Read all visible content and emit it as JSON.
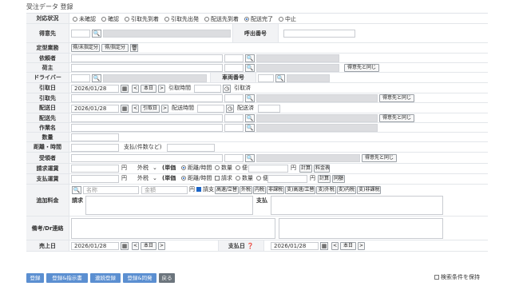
{
  "page_title": "受注データ 登録",
  "status": {
    "label": "対応状況",
    "options": [
      "未確認",
      "確認",
      "引取先到着",
      "引取先出発",
      "配送先到着",
      "配送完了",
      "中止"
    ],
    "selected": "配送完了"
  },
  "labels": {
    "customer": "得意先",
    "caller": "呼出番号",
    "fixed": "定型業務",
    "requester": "依頼者",
    "shipper": "荷主",
    "driver": "ドライバー",
    "vehicle": "車両番号",
    "pickup_date": "引取日",
    "pickup_place": "引取先",
    "delivery_date": "配送日",
    "delivery_place": "配送先",
    "work_name": "作業名",
    "quantity": "数量",
    "distance_time": "距離・時間",
    "recipient": "受領者",
    "billing_fare": "請求運賃",
    "payment_fare": "支払運賃",
    "extra_fee": "追加料金",
    "notes": "備考/Dr連絡",
    "sales_date": "売上日",
    "payment_date": "支払日"
  },
  "buttons": {
    "fixed_unassigned": "得/未指定分",
    "fixed_assigned": "得/指定分",
    "same_as_customer": "得意先と同じ",
    "today": "本日",
    "pickup_time_label": "引取時間",
    "pickup_done": "引取済",
    "pickup_today": "引取日",
    "delivery_time_label": "配送時間",
    "delivery_done": "配送済",
    "calc": "計算",
    "fee_table": "料金表",
    "same": "同額",
    "prev": "<",
    "next": ">"
  },
  "dates": {
    "pickup": "2026/01/28",
    "delivery": "2026/01/28",
    "sales": "2026/01/28",
    "payment": "2026/01/28"
  },
  "distance": {
    "pieces_label": "支払(件数など)"
  },
  "fare": {
    "unit": "円",
    "tax": "外税",
    "unit_label": "(単価",
    "opt_distance": "距離/時間",
    "opt_qty": "数量",
    "opt_flight": "便",
    "billing_extra": "",
    "payment_extra": "請求"
  },
  "extra": {
    "name_ph": "名称",
    "amount_ph": "金額",
    "yen": "円",
    "billing_chk": "請支",
    "tags": [
      "高速/立替",
      "外税",
      "内税",
      "非課税",
      "支)高速/立替",
      "支)外税",
      "支)内税",
      "支)非課税"
    ],
    "billing": "請求",
    "payment": "支払"
  },
  "footer": {
    "register": "登録",
    "register_instruction": "登録&指示書",
    "continuous": "連続登録",
    "register_same": "登録&同発",
    "back": "戻る",
    "keep_search": "検索条件を保持"
  }
}
